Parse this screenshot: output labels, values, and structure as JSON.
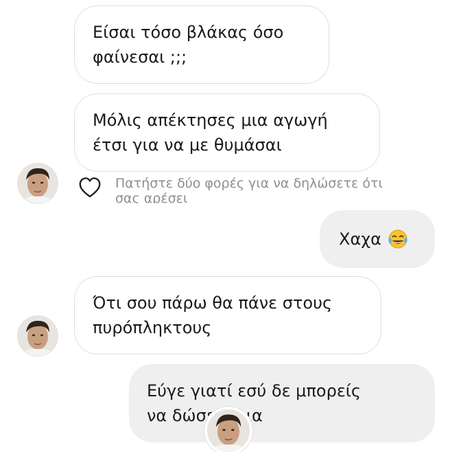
{
  "messages": [
    {
      "text": "Είσαι τόσο βλάκας όσο\nφαίνεσαι ;;;",
      "sender": "them"
    },
    {
      "text": "Μόλις απέκτησες μια αγωγή\nέτσι για να με θυμάσαι",
      "sender": "them"
    },
    {
      "text": "Χαχα",
      "emoji": "face-with-tears-of-joy",
      "sender": "me"
    },
    {
      "text": "Ότι σου πάρω θα πάνε στους\nπυρόπληκτους",
      "sender": "them"
    },
    {
      "text": "Εύγε γιατί εσύ δε μπορείς\nνα δώσεις μια",
      "sender": "me"
    }
  ],
  "like_hint": "Πατήστε δύο φορές για να δηλώσετε ότι σας αρέσει",
  "icons": {
    "heart": "heart-outline-icon",
    "emoji": "face-with-tears-of-joy-icon"
  },
  "colors": {
    "incoming_bubble_border": "#dedede",
    "outgoing_bubble_bg": "#efefef",
    "hint_text": "#8e8e8e"
  }
}
